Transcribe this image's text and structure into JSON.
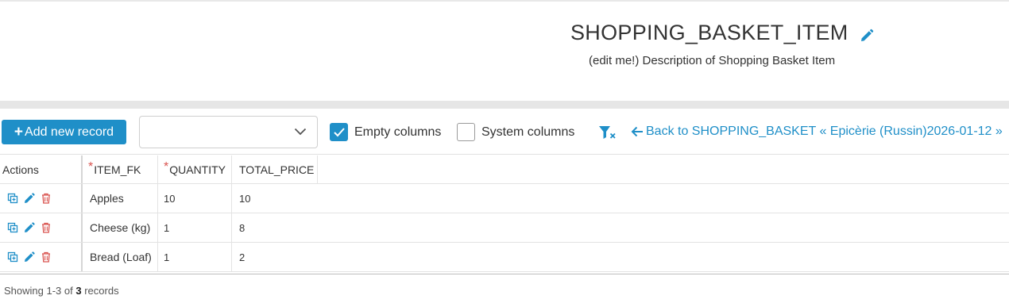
{
  "header": {
    "title": "SHOPPING_BASKET_ITEM",
    "description": "(edit me!) Description of Shopping Basket Item"
  },
  "toolbar": {
    "add_label": "Add new record",
    "select_value": "",
    "empty_columns_label": "Empty columns",
    "empty_columns_checked": true,
    "system_columns_label": "System columns",
    "system_columns_checked": false,
    "back_link": "Back to SHOPPING_BASKET « Epicèrie (Russin)2026-01-12 »"
  },
  "table": {
    "columns": [
      {
        "label": "Actions",
        "required": false
      },
      {
        "label": "ITEM_FK",
        "required": true
      },
      {
        "label": "QUANTITY",
        "required": true
      },
      {
        "label": "TOTAL_PRICE",
        "required": false
      }
    ],
    "rows": [
      {
        "item_fk": "Apples",
        "quantity": "10",
        "total_price": "10"
      },
      {
        "item_fk": "Cheese (kg)",
        "quantity": "1",
        "total_price": "8"
      },
      {
        "item_fk": "Bread (Loaf)",
        "quantity": "1",
        "total_price": "2"
      }
    ]
  },
  "footer": {
    "prefix": "Showing 1-3 of",
    "count": "3",
    "suffix": "records"
  },
  "colors": {
    "accent": "#1f8fc8",
    "danger": "#d9534f",
    "required": "#d9534f"
  }
}
